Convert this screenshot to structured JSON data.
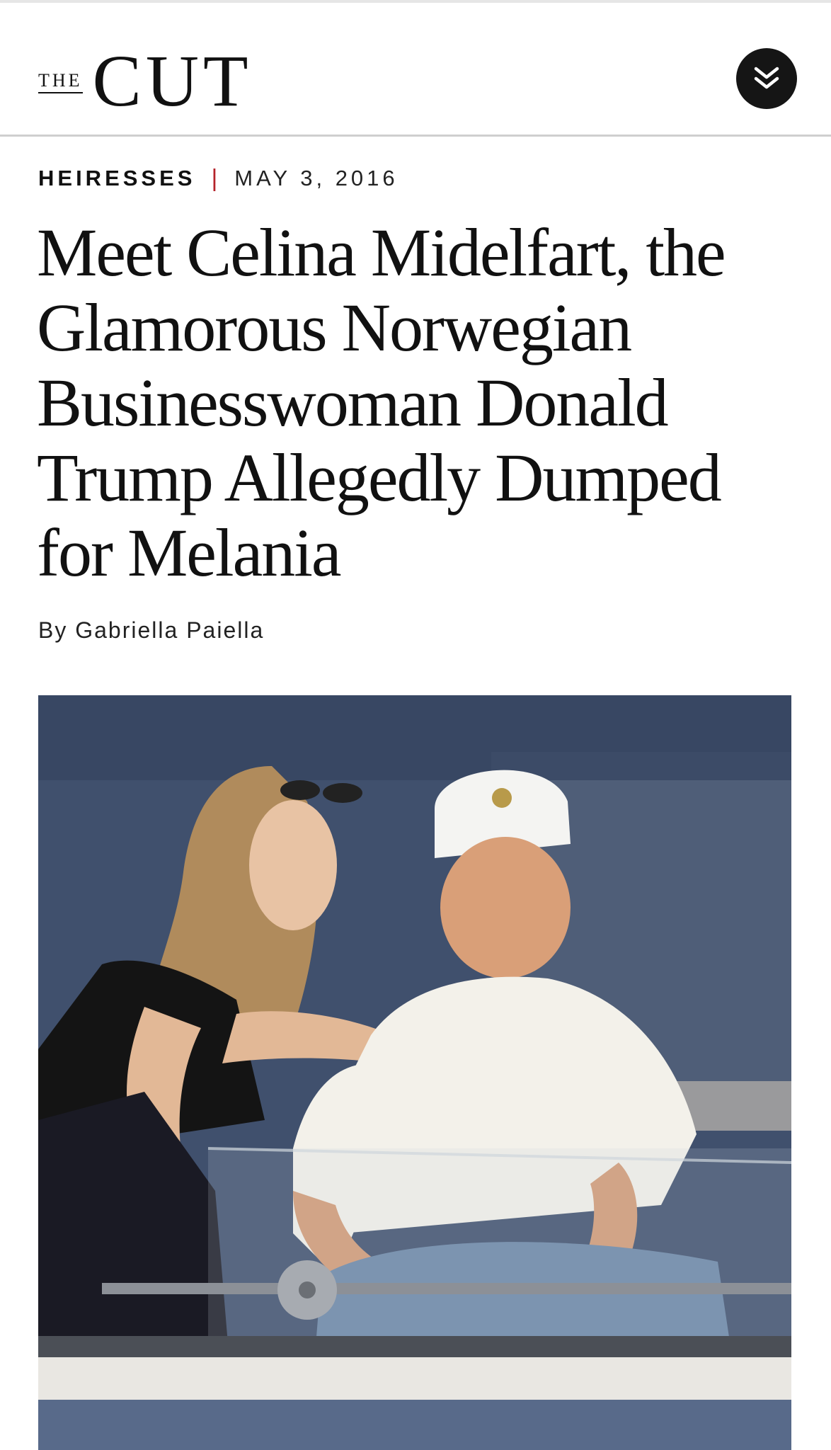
{
  "header": {
    "logo_the": "THE",
    "logo_cut": "CUT",
    "menu_icon": "double-chevron-down-icon"
  },
  "article": {
    "rubric": "HEIRESSES",
    "separator": "|",
    "date": "MAY 3, 2016",
    "headline": "Meet Celina Midelfart, the Glamorous Norwegian Businesswoman Donald Trump Allegedly Dumped for Melania",
    "byline": "By Gabriella Paiella"
  },
  "colors": {
    "accent_separator": "#b5232a",
    "menu_button_bg": "#151515",
    "header_rule": "#cfcfcf"
  }
}
